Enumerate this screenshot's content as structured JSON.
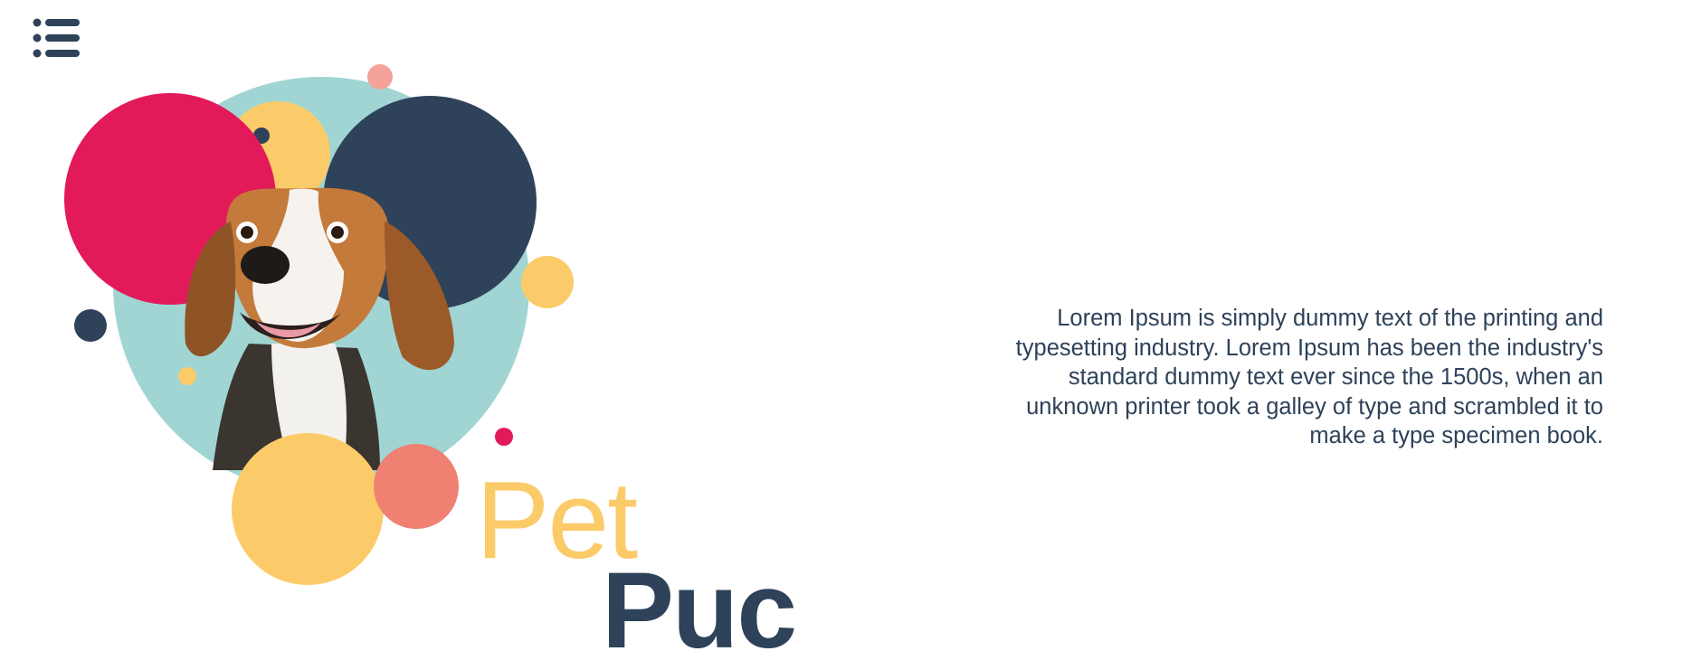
{
  "header": {
    "menu_icon": "list-icon"
  },
  "brand": {
    "word_top": "Pet",
    "word_bottom": "Puc",
    "colors": {
      "yellow": "#fccb69",
      "navy": "#2e4259",
      "pink": "#e21a5a",
      "teal": "#a0d5d3",
      "coral": "#ef8072"
    }
  },
  "main": {
    "description": "Lorem Ipsum is simply dummy text of the printing and typesetting industry. Lorem Ipsum has been the industry's standard dummy text ever since the 1500s, when an unknown printer took a galley of type and scrambled it to make a type specimen book."
  }
}
